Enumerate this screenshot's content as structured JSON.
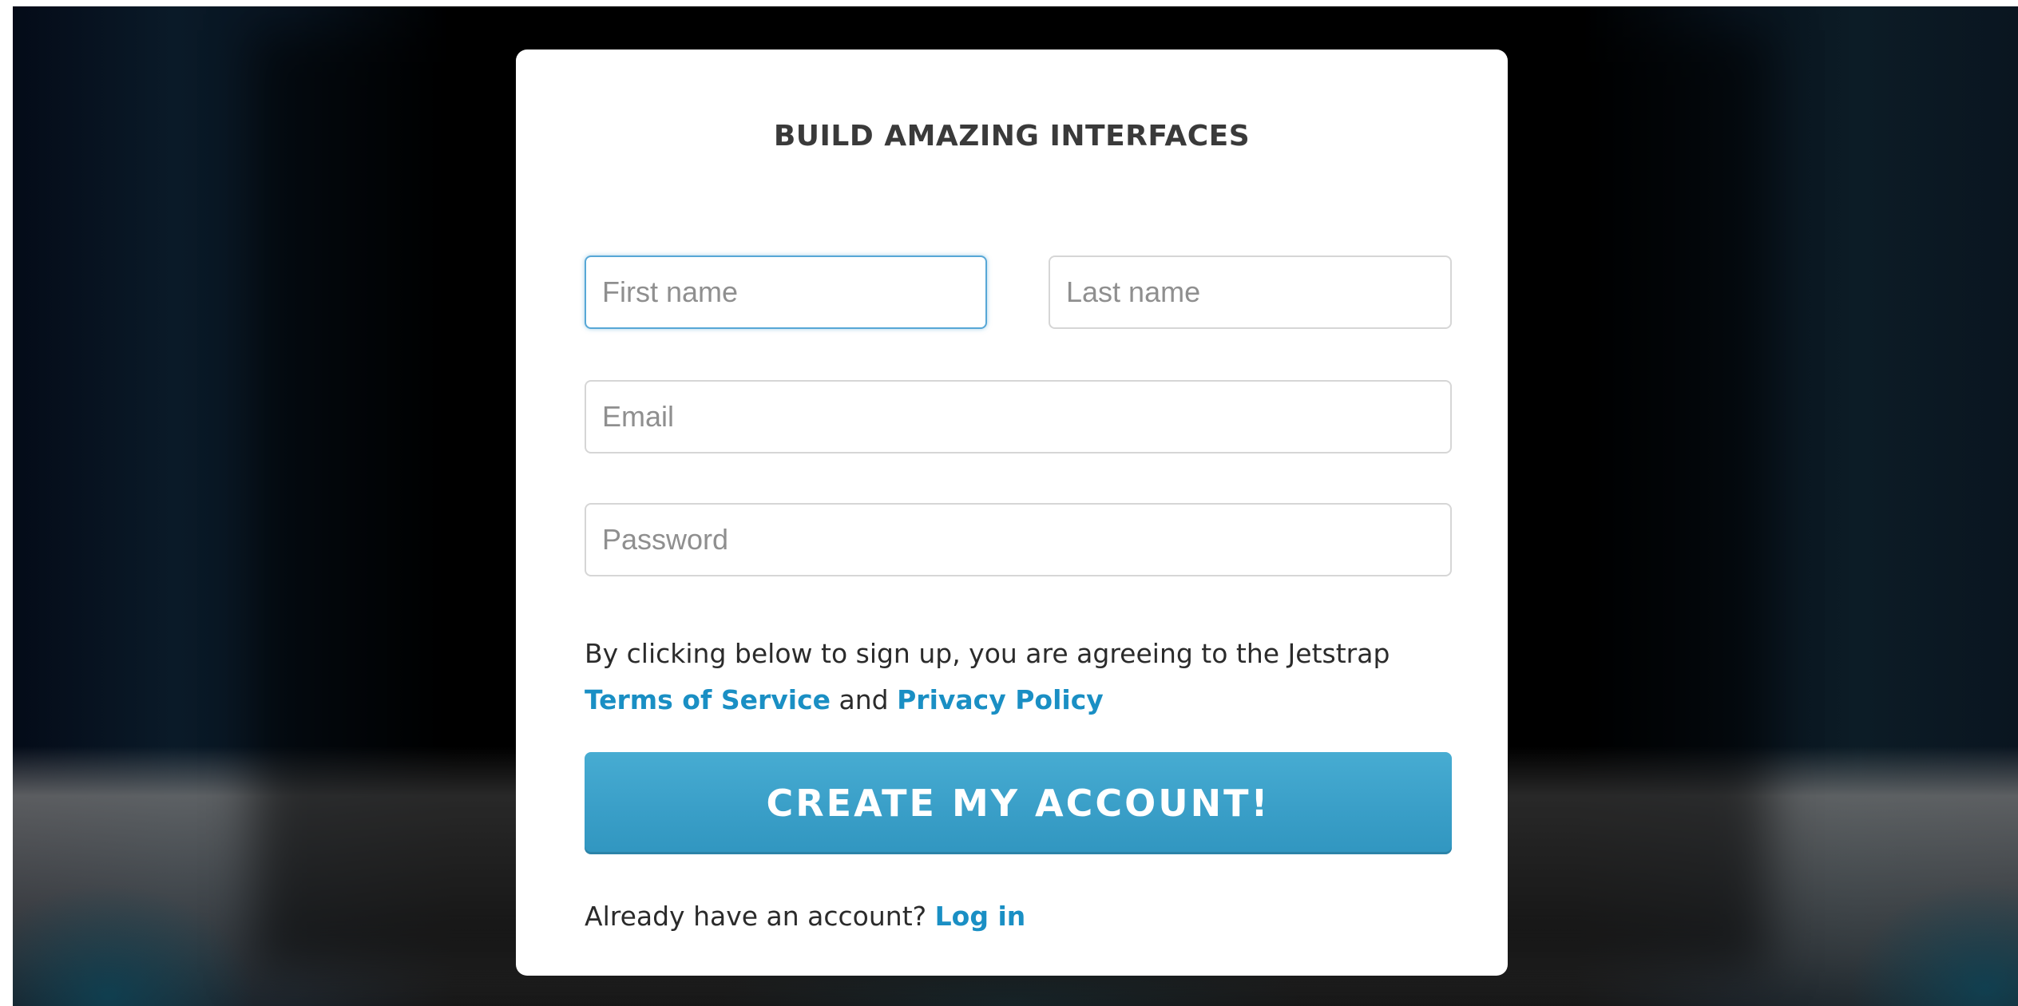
{
  "signup": {
    "title": "BUILD AMAZING INTERFACES",
    "first_name": {
      "placeholder": "First name",
      "value": ""
    },
    "last_name": {
      "placeholder": "Last name",
      "value": ""
    },
    "email": {
      "placeholder": "Email",
      "value": ""
    },
    "password": {
      "placeholder": "Password",
      "value": ""
    },
    "terms_text": "By clicking below to sign up, you are agreeing to the Jetstrap",
    "terms_link": "Terms of Service",
    "terms_and": "and",
    "privacy_link": "Privacy Policy",
    "submit_label": "CREATE MY ACCOUNT!",
    "login_prompt": "Already have an account?",
    "login_link": "Log in"
  },
  "colors": {
    "accent": "#3a9fc8",
    "link": "#1a8fc4",
    "focus_border": "#57a7d6"
  }
}
